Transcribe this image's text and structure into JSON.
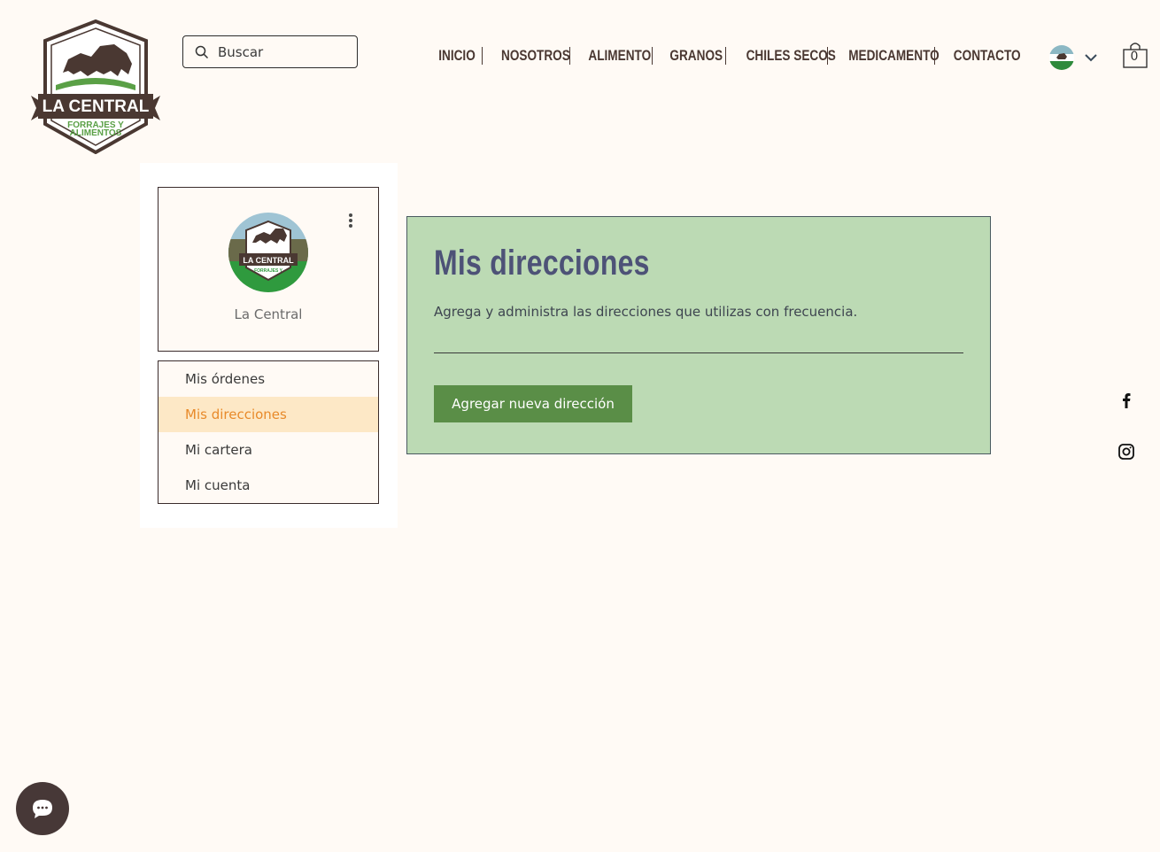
{
  "header": {
    "logo": {
      "title": "LA CENTRAL",
      "subtitle_1": "FORRAJES Y",
      "subtitle_2": "ALIMENTOS"
    },
    "search": {
      "placeholder": "Buscar"
    },
    "nav": [
      "INICIO",
      "NOSOTROS",
      "ALIMENTO",
      "GRANOS",
      "CHILES SECOS",
      "MEDICAMENTO",
      "CONTACTO"
    ],
    "cart": {
      "count": "0"
    }
  },
  "sidebar": {
    "profile_name": "La Central",
    "menu": [
      "Mis órdenes",
      "Mis direcciones",
      "Mi cartera",
      "Mi cuenta"
    ],
    "active_index": 1
  },
  "main": {
    "title": "Mis direcciones",
    "description": "Agrega y administra las direcciones que utilizas con frecuencia.",
    "add_button": "Agregar nueva dirección"
  },
  "colors": {
    "background": "#fffaf5",
    "panel": "#bcdab4",
    "button": "#5a8e47",
    "active_menu_bg": "#fde8c6",
    "active_menu_text": "#e88a2a",
    "title": "#4d5277",
    "nav": "#4a3832"
  },
  "icons": [
    "search-icon",
    "chevron-down-icon",
    "cart-icon",
    "more-vertical-icon",
    "facebook-icon",
    "instagram-icon",
    "chat-icon"
  ]
}
